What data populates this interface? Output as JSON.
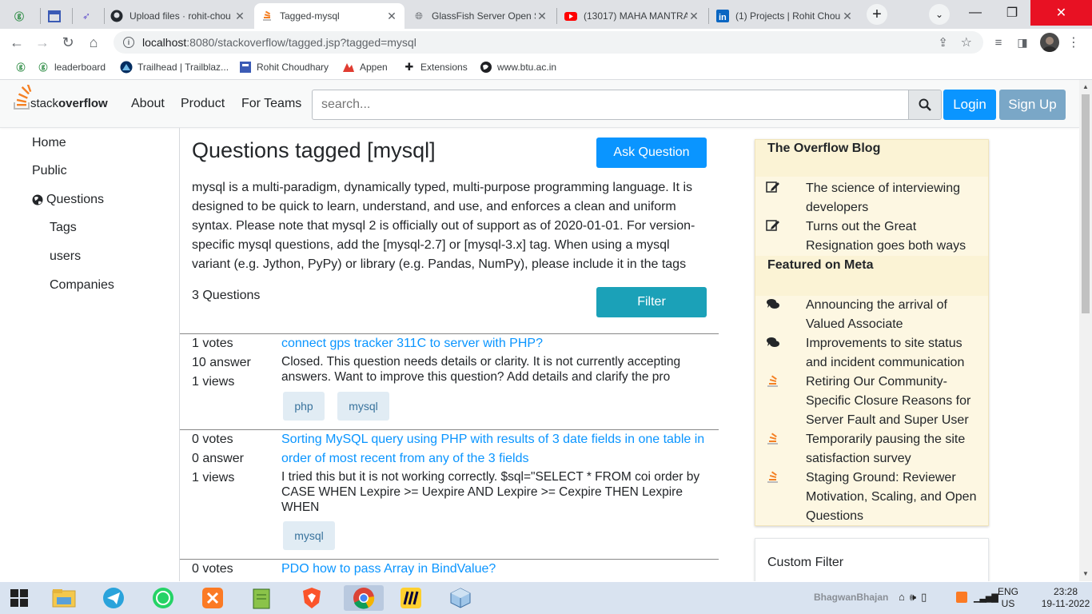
{
  "browser": {
    "tabs": [
      {
        "title": "",
        "icon": "gfg-icon"
      },
      {
        "title": "",
        "icon": "calendar-icon"
      },
      {
        "title": "",
        "icon": "rocket-icon"
      },
      {
        "title": "Upload files · rohit-chou",
        "icon": "github-icon"
      },
      {
        "title": "Tagged-mysql",
        "icon": "stackoverflow-icon",
        "active": true
      },
      {
        "title": "GlassFish Server Open S",
        "icon": "globe-icon"
      },
      {
        "title": "(13017) MAHA MANTRA",
        "icon": "youtube-icon"
      },
      {
        "title": "(1) Projects | Rohit Chou",
        "icon": "linkedin-icon"
      }
    ],
    "new_tab": "+",
    "url_host": "localhost",
    "url_rest": ":8080/stackoverflow/tagged.jsp?tagged=mysql",
    "bookmarks": [
      {
        "label": "",
        "icon": "gfg-icon"
      },
      {
        "label": "leaderboard",
        "icon": "gfg-icon"
      },
      {
        "label": "Trailhead | Trailblaz...",
        "icon": "trailhead-icon"
      },
      {
        "label": "Rohit Choudhary",
        "icon": "bookmark-icon"
      },
      {
        "label": "Appen",
        "icon": "appen-icon"
      },
      {
        "label": "Extensions",
        "icon": "puzzle-icon"
      },
      {
        "label": "www.btu.ac.in",
        "icon": "globe-icon"
      }
    ]
  },
  "header": {
    "logo_prefix": "stack",
    "logo_suffix": "overflow",
    "nav": [
      "About",
      "Product",
      "For Teams"
    ],
    "search_placeholder": "search...",
    "login": "Login",
    "signup": "Sign Up"
  },
  "sidebar": {
    "items": [
      "Home",
      "Public",
      "Questions",
      "Tags",
      "users",
      "Companies"
    ]
  },
  "main": {
    "title": "Questions tagged [mysql]",
    "ask_button": "Ask Question",
    "description": "mysql is a multi-paradigm, dynamically typed, multi-purpose programming language. It is designed to be quick to learn, understand, and use, and enforces a clean and uniform syntax. Please note that mysql 2 is officially out of support as of 2020-01-01. For version-specific mysql questions, add the [mysql-2.7] or [mysql-3.x] tag. When using a mysql variant (e.g. Jython, PyPy) or library (e.g. Pandas, NumPy), please include it in the tags",
    "count": "3 Questions",
    "filter_button": "Filter",
    "questions": [
      {
        "votes": "1 votes",
        "answers": "10 answer",
        "views": "1 views",
        "title": "connect gps tracker 311C to server with PHP?",
        "excerpt": "Closed. This question needs details or clarity. It is not currently accepting answers. Want to improve this question? Add details and clarify the pro",
        "tags": [
          "php",
          "mysql"
        ]
      },
      {
        "votes": "0 votes",
        "answers": "0 answer",
        "views": "1 views",
        "title": "Sorting MySQL query using PHP with results of 3 date fields in one table in order of most recent from any of the 3 fields",
        "excerpt": "I tried this but it is not working correctly. $sql=\"SELECT * FROM coi order by CASE WHEN Lexpire >= Uexpire AND Lexpire >= Cexpire THEN Lexpire WHEN",
        "tags": [
          "mysql"
        ]
      },
      {
        "votes": "0 votes",
        "answers": "",
        "views": "",
        "title": "PDO how to pass Array in BindValue?",
        "excerpt": "",
        "tags": []
      }
    ]
  },
  "rightbar": {
    "blog_title": "The Overflow Blog",
    "blog_items": [
      {
        "text": "The science of interviewing developers",
        "icon": "pencil-icon"
      },
      {
        "text": "Turns out the Great Resignation goes both ways",
        "icon": "pencil-icon"
      }
    ],
    "meta_title": "Featured on Meta",
    "meta_items": [
      {
        "text": "Announcing the arrival of Valued Associate",
        "icon": "comments-icon"
      },
      {
        "text": "Improvements to site status and incident communication",
        "icon": "comments-icon"
      },
      {
        "text": "Retiring Our Community-Specific Closure Reasons for Server Fault and Super User",
        "icon": "stackoverflow-icon"
      },
      {
        "text": "Temporarily pausing the site satisfaction survey",
        "icon": "stackoverflow-icon"
      },
      {
        "text": "Staging Ground: Reviewer Motivation, Scaling, and Open Questions",
        "icon": "stackoverflow-icon"
      }
    ],
    "custom_filter": "Custom Filter"
  },
  "taskbar": {
    "watermark": "BhagwanBhajan",
    "lang1": "ENG",
    "lang2": "US",
    "time": "23:28",
    "date": "19-11-2022"
  },
  "colors": {
    "accent": "#0a95ff",
    "filter": "#1ba1b8",
    "signup": "#7aa7c7",
    "sidebar_box": "#fdf7e2"
  }
}
